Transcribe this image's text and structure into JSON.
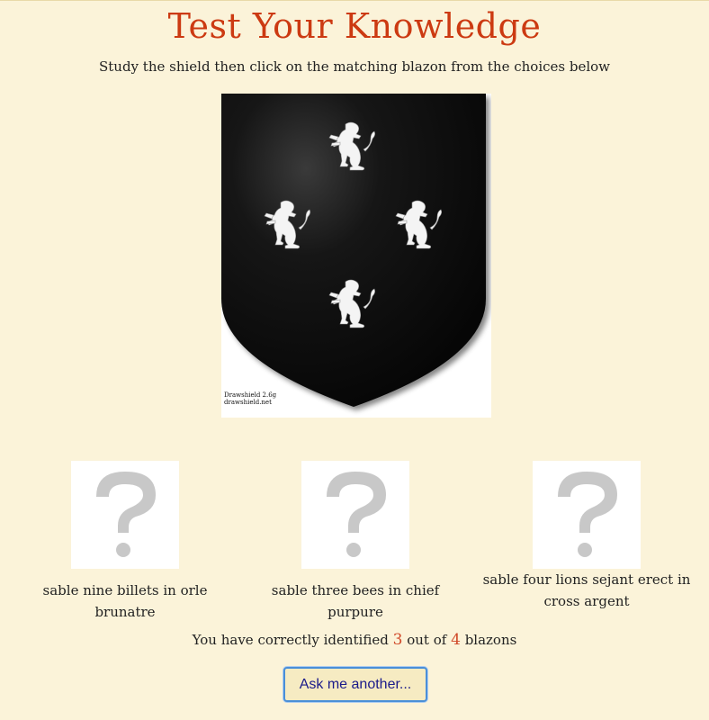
{
  "page": {
    "title": "Test Your Knowledge",
    "instructions": "Study the shield then click on the matching blazon from the choices below"
  },
  "shield": {
    "field_color": "#0a0a0a",
    "charge_color": "#f4f4f4",
    "watermark_line1": "Drawshield 2.6g",
    "watermark_line2": "drawshield.net"
  },
  "choices": [
    {
      "icon": "question-mark-icon",
      "label": "sable nine billets in orle brunatre"
    },
    {
      "icon": "question-mark-icon",
      "label": "sable three bees in chief purpure"
    },
    {
      "icon": "question-mark-icon",
      "label": "sable four lions sejant erect in cross argent"
    }
  ],
  "score": {
    "prefix": "You have correctly identified",
    "correct": "3",
    "middle": "out of",
    "total": "4",
    "suffix": "blazons"
  },
  "button": {
    "label": "Ask me another..."
  },
  "colors": {
    "background": "#fbf3d9",
    "title": "#cc3a12",
    "score_numbers": "#d04a2a",
    "button_border": "#4a8fd8",
    "button_text": "#1a1a8a"
  }
}
